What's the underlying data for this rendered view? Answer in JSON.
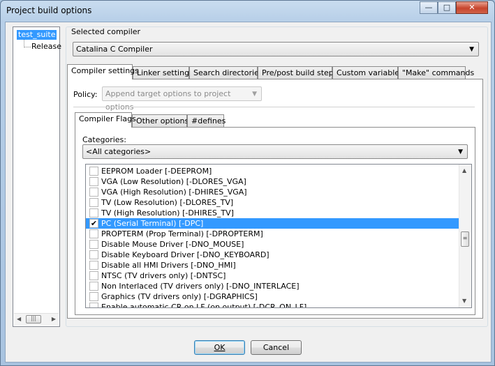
{
  "window": {
    "title": "Project build options",
    "minimize_glyph": "—",
    "maximize_glyph": "□",
    "close_glyph": "✕"
  },
  "tree": {
    "root": "test_suite",
    "child": "Release"
  },
  "compiler": {
    "label": "Selected compiler",
    "value": "Catalina C Compiler"
  },
  "main_tabs": [
    {
      "label": "Compiler settings",
      "active": true
    },
    {
      "label": "Linker settings"
    },
    {
      "label": "Search directories"
    },
    {
      "label": "Pre/post build steps"
    },
    {
      "label": "Custom variables"
    },
    {
      "label": "\"Make\" commands"
    }
  ],
  "policy": {
    "label": "Policy:",
    "value": "Append target options to project options"
  },
  "sub_tabs": [
    {
      "label": "Compiler Flags",
      "active": true
    },
    {
      "label": "Other options"
    },
    {
      "label": "#defines"
    }
  ],
  "categories": {
    "label": "Categories:",
    "value": "<All categories>"
  },
  "flags": [
    {
      "label": "EEPROM Loader  [-DEEPROM]",
      "checked": false
    },
    {
      "label": "VGA (Low Resolution)  [-DLORES_VGA]",
      "checked": false
    },
    {
      "label": "VGA (High Resolution)  [-DHIRES_VGA]",
      "checked": false
    },
    {
      "label": "TV (Low Resolution)  [-DLORES_TV]",
      "checked": false
    },
    {
      "label": "TV (High Resolution)  [-DHIRES_TV]",
      "checked": false
    },
    {
      "label": "PC (Serial Terminal)  [-DPC]",
      "checked": true,
      "selected": true
    },
    {
      "label": "PROPTERM (Prop Terminal)  [-DPROPTERM]",
      "checked": false
    },
    {
      "label": "Disable Mouse Driver  [-DNO_MOUSE]",
      "checked": false
    },
    {
      "label": "Disable Keyboard Driver  [-DNO_KEYBOARD]",
      "checked": false
    },
    {
      "label": "Disable all HMI Drivers  [-DNO_HMI]",
      "checked": false
    },
    {
      "label": "NTSC (TV drivers only)  [-DNTSC]",
      "checked": false
    },
    {
      "label": "Non Interlaced (TV drivers only)  [-DNO_INTERLACE]",
      "checked": false
    },
    {
      "label": "Graphics (TV drivers only)  [-DGRAPHICS]",
      "checked": false
    },
    {
      "label": "Enable automatic CR on LF (on output)  [-DCR_ON_LF]",
      "checked": false
    }
  ],
  "buttons": {
    "ok": "OK",
    "cancel": "Cancel"
  },
  "check_glyph": "✔"
}
